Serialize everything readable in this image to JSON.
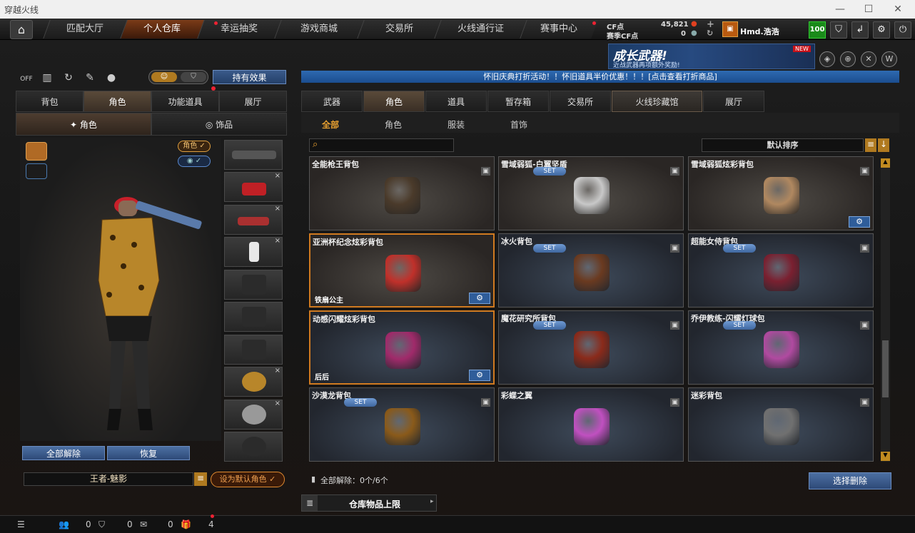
{
  "window": {
    "title": "穿越火线",
    "min": "—",
    "max": "☐",
    "close": "✕"
  },
  "nav": {
    "tabs": [
      "匹配大厅",
      "个人仓库",
      "幸运抽奖",
      "游戏商城",
      "交易所",
      "火线通行证",
      "赛事中心"
    ],
    "active_index": 1,
    "cf_label": "CF点",
    "cf_value": "45,821",
    "event_cf_label": "赛季CF点",
    "event_cf_value": "0",
    "username": "Hmd.浩浩",
    "level": "100"
  },
  "banner": {
    "title": "成长武器!",
    "subtitle": "近战武器再项额外奖励!",
    "badge": "NEW"
  },
  "notice": "怀旧庆典打折活动！！怀旧道具半价优惠！！！[点击查看打折商品]",
  "left": {
    "toggle_label": "OFF",
    "effect_button": "持有效果",
    "tabs": [
      "背包",
      "角色",
      "功能道具",
      "展厅"
    ],
    "tabs_active": 1,
    "subtabs": [
      "角色",
      "饰品"
    ],
    "subtabs_active": 0,
    "role_badge": "角色",
    "unequip_all": "全部解除",
    "restore": "恢复",
    "character_name": "王者-魅影",
    "set_default": "设为默认角色"
  },
  "right": {
    "tabs": [
      "武器",
      "角色",
      "道具",
      "暂存箱",
      "交易所",
      "火线珍藏馆",
      "展厅"
    ],
    "tabs_active": 1,
    "subtabs": [
      "全部",
      "角色",
      "服装",
      "首饰"
    ],
    "subtabs_active": 0,
    "search_icon": "search-icon",
    "sort_label": "默认排序",
    "cards": [
      {
        "name": "全能枪王背包",
        "set": "",
        "tag": "",
        "gear": false,
        "sel": false,
        "blue": false,
        "color": "#4a3a2a"
      },
      {
        "name": "雪域弱狐-白翼坚盾",
        "set": "SET",
        "tag": "",
        "gear": false,
        "sel": false,
        "blue": false,
        "color": "#c8c8c8"
      },
      {
        "name": "雪域弱狐炫彩背包",
        "set": "",
        "tag": "",
        "gear": true,
        "sel": false,
        "blue": false,
        "color": "#b08860"
      },
      {
        "name": "亚洲杯纪念炫彩背包",
        "set": "",
        "tag": "铁扇公主",
        "gear": true,
        "sel": true,
        "blue": false,
        "color": "#c0302a"
      },
      {
        "name": "冰火背包",
        "set": "SET",
        "tag": "",
        "gear": false,
        "sel": false,
        "blue": true,
        "color": "#6a3a20"
      },
      {
        "name": "超能女侍背包",
        "set": "SET",
        "tag": "",
        "gear": false,
        "sel": false,
        "blue": true,
        "color": "#7a2030"
      },
      {
        "name": "动感闪耀炫彩背包",
        "set": "",
        "tag": "后后",
        "gear": true,
        "sel": true,
        "blue": true,
        "color": "#a02a6a"
      },
      {
        "name": "魔花研究所背包",
        "set": "SET",
        "tag": "",
        "gear": false,
        "sel": false,
        "blue": true,
        "color": "#8a2a1a"
      },
      {
        "name": "乔伊教练-闪耀灯球包",
        "set": "SET",
        "tag": "",
        "gear": false,
        "sel": false,
        "blue": true,
        "color": "#b04aa0"
      },
      {
        "name": "沙漠龙背包",
        "set": "SET",
        "tag": "",
        "gear": false,
        "sel": false,
        "blue": true,
        "color": "#8a5a1a"
      },
      {
        "name": "彩蝶之翼",
        "set": "",
        "tag": "",
        "gear": false,
        "sel": false,
        "blue": true,
        "color": "#c050c0"
      },
      {
        "name": "迷彩背包",
        "set": "",
        "tag": "",
        "gear": false,
        "sel": false,
        "blue": true,
        "color": "#707070"
      }
    ],
    "unequip_status": "全部解除：0个/6个",
    "choose_delete": "选择删除",
    "warehouse_limit": "仓库物品上限"
  },
  "status": {
    "friends": "0",
    "shield": "0",
    "chat": "0",
    "gift": "4"
  }
}
